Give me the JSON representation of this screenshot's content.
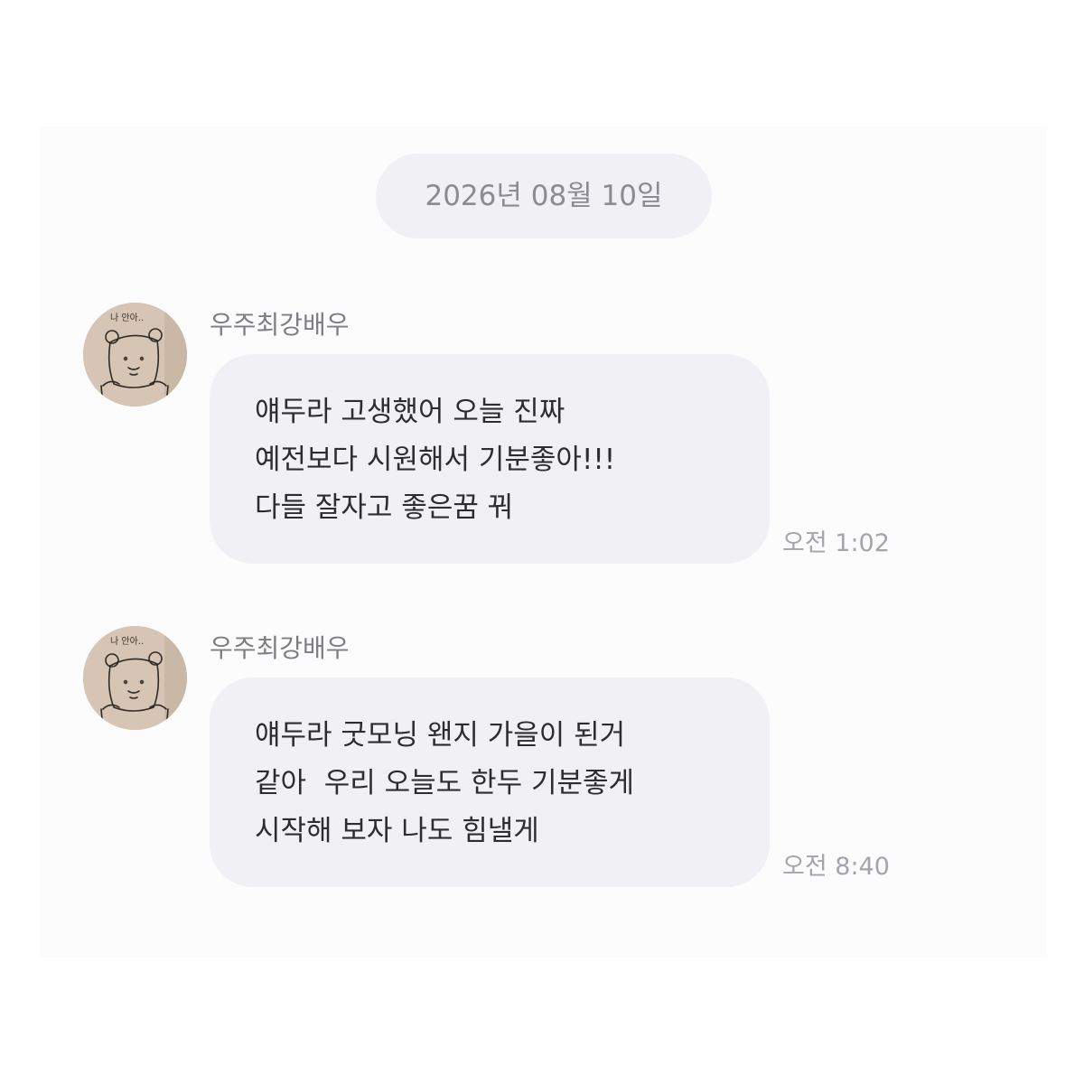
{
  "date_separator": "2026년 08월 10일",
  "messages": [
    {
      "sender": "우주최강배우",
      "avatar_icon": "bear-drawing-avatar",
      "avatar_caption": "나 안아..",
      "lines": [
        "얘두라 고생했어 오늘 진짜",
        "예전보다 시원해서 기분좋아!!!",
        "다들 잘자고 좋은꿈 꿔"
      ],
      "time": "오전 1:02"
    },
    {
      "sender": "우주최강배우",
      "avatar_icon": "bear-drawing-avatar",
      "avatar_caption": "나 안아..",
      "lines": [
        "얘두라 굿모닝 왠지 가을이 된거",
        "같아  우리 오늘도 한두 기분좋게",
        "시작해 보자 나도 힘낼게"
      ],
      "time": "오전 8:40"
    }
  ],
  "colors": {
    "chat_background": "#fcfcfd",
    "bubble": "#f1f1f5",
    "message_text": "#2d2d31",
    "timestamp": "#a4a5ac"
  }
}
